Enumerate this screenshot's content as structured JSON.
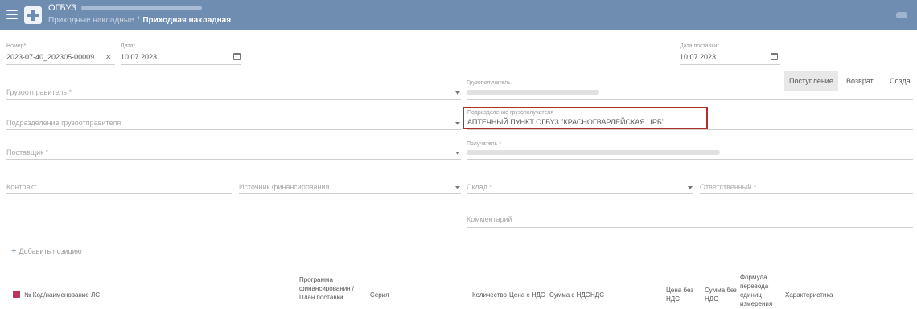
{
  "header": {
    "org_name": "ОГБУЗ",
    "breadcrumb_parent": "Приходные накладные",
    "breadcrumb_current": "Приходная накладная"
  },
  "form": {
    "number_label": "Номер*",
    "number_value": "2023-07-40_202305-00009",
    "date_label": "Дата*",
    "date_value": "10.07.2023",
    "doc_date_label": "Дата поставки*",
    "doc_date_value": "10.07.2023",
    "supplier_placeholder": "Грузоотправитель *",
    "consignee_label": "Грузополучатель",
    "supplier_division_placeholder": "Подразделение грузоотправителя",
    "receiver_division_label": "Подразделение грузополучателя",
    "receiver_division_value": "АПТЕЧНЫЙ ПУНКТ ОГБУЗ \"КРАСНОГВАРДЕЙСКАЯ ЦРБ\"",
    "supplier2_placeholder": "Поставщик *",
    "recipient_label": "Получатель *",
    "contract_placeholder": "Контракт",
    "funding_placeholder": "Источник финансирования",
    "warehouse_placeholder": "Склад *",
    "responsible_placeholder": "Ответственный *",
    "comment_placeholder": "Комментарий"
  },
  "tabs": [
    "Поступление",
    "Возврат",
    "Созда"
  ],
  "add_position": "Добавить позицию",
  "table_headers": [
    "№ Код/наименование ЛС",
    "Программа финансирования / План поставки",
    "Серия",
    "Количество",
    "Цена с НДС",
    "Сумма с НДС",
    "НДС",
    "Цена без НДС",
    "Сумма без НДС",
    "Формула перевода единиц измерения",
    "Характеристика"
  ]
}
